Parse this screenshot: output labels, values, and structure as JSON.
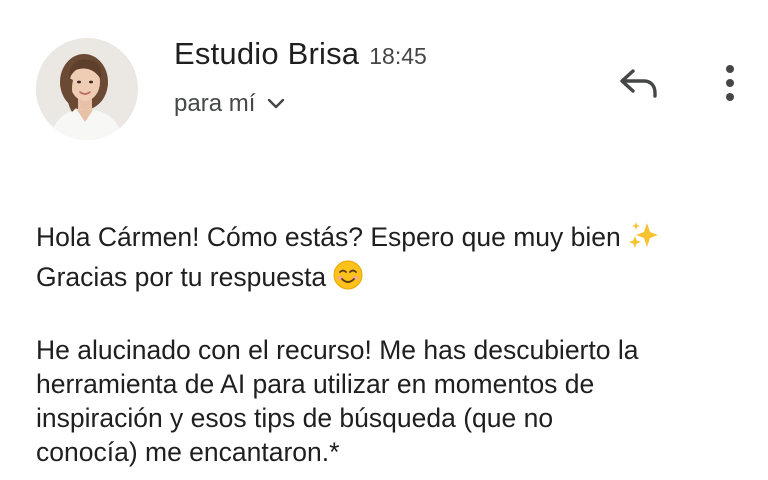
{
  "header": {
    "sender_name": "Estudio Brisa",
    "time": "18:45",
    "recipient": "para mí"
  },
  "icons": {
    "avatar": "avatar-photo",
    "recipient_toggle": "chevron-down-icon",
    "reply": "reply-icon",
    "more": "more-vert-icon"
  },
  "message": {
    "paragraph_1": {
      "line_1": "Hola Cármen! Cómo estás? Espero que muy bien",
      "line_1_emoji": "sparkles-emoji",
      "line_2": "Gracias por tu respuesta",
      "line_2_emoji": "smiling-face-emoji"
    },
    "paragraph_2": {
      "line_1": "He alucinado con el recurso! Me has descubierto la",
      "line_2": "herramienta de AI para utilizar en momentos de",
      "line_3": "inspiración y esos tips de búsqueda (que no",
      "line_4": "conocía) me encantaron.*"
    }
  },
  "colors": {
    "text_primary": "#1f1f1f",
    "text_secondary": "#444746",
    "icon": "#444746",
    "sparkle": "#f7c230",
    "smile_face": "#fcc21b"
  }
}
